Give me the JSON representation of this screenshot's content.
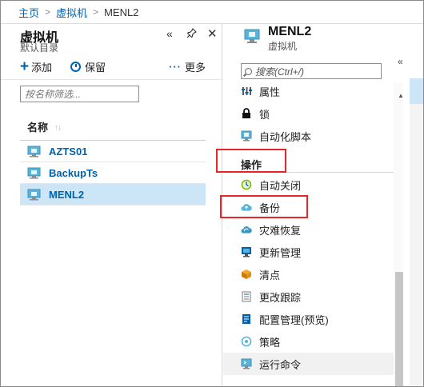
{
  "breadcrumb": {
    "home": "主页",
    "vms": "虚拟机",
    "current": "MENL2",
    "separator": ">"
  },
  "left_blade": {
    "title": "虚拟机",
    "subtitle": "默认目录",
    "controls": {
      "collapse": "«",
      "pin": "pin-icon",
      "close": "✕"
    },
    "toolbar": {
      "add_label": "添加",
      "reserve_label": "保留",
      "more_label": "更多"
    },
    "filter_placeholder": "按名称筛选...",
    "column_header": "名称",
    "vms": [
      {
        "name": "AZTS01",
        "selected": false
      },
      {
        "name": "BackupTs",
        "selected": false
      },
      {
        "name": "MENL2",
        "selected": true
      }
    ]
  },
  "right_blade": {
    "title": "MENL2",
    "subtitle": "虚拟机",
    "collapse": "«",
    "search_placeholder": "搜索(Ctrl+/)",
    "menu_top": [
      {
        "label": "属性",
        "icon": "properties-icon"
      },
      {
        "label": "锁",
        "icon": "lock-icon"
      },
      {
        "label": "自动化脚本",
        "icon": "automation-script-icon"
      }
    ],
    "section_label": "操作",
    "menu_ops": [
      {
        "label": "自动关闭",
        "icon": "auto-shutdown-icon"
      },
      {
        "label": "备份",
        "icon": "backup-icon"
      },
      {
        "label": "灾难恢复",
        "icon": "disaster-recovery-icon"
      },
      {
        "label": "更新管理",
        "icon": "update-management-icon"
      },
      {
        "label": "清点",
        "icon": "inventory-icon"
      },
      {
        "label": "更改跟踪",
        "icon": "change-tracking-icon"
      },
      {
        "label": "配置管理(预览)",
        "icon": "configuration-management-icon"
      },
      {
        "label": "策略",
        "icon": "policy-icon"
      },
      {
        "label": "运行命令",
        "icon": "run-command-icon"
      }
    ]
  },
  "colors": {
    "link": "#0062ad",
    "selected_row": "#cde6f7",
    "highlight_box": "#e8262a"
  }
}
